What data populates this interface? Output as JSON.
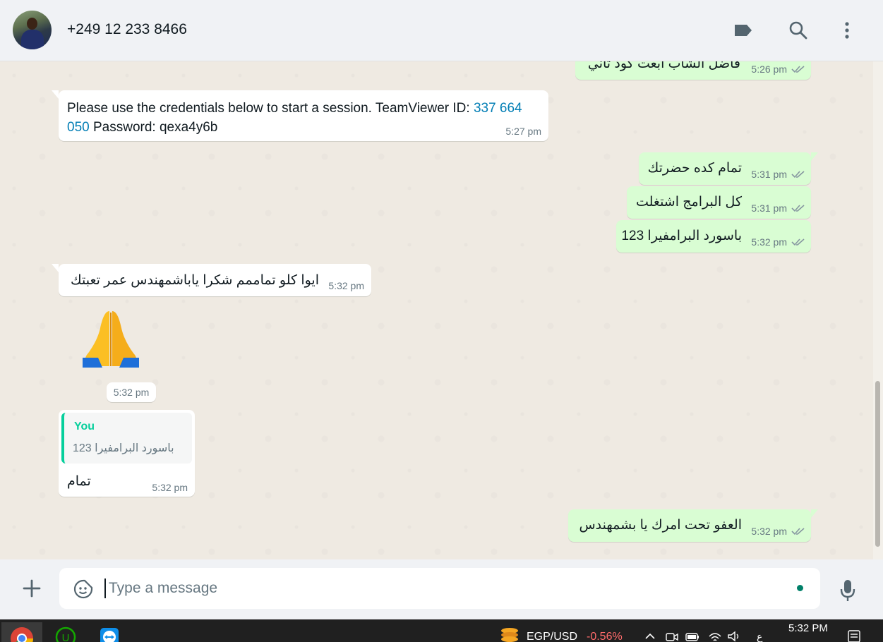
{
  "header": {
    "contact_name": "+249 12 233 8466",
    "icons": [
      "label-icon",
      "search-icon",
      "kebab-menu-icon"
    ]
  },
  "messages": [
    {
      "dir": "out",
      "text": "فاضل الشاب ابعت كود تاني",
      "time": "5:26 pm",
      "status": "read"
    },
    {
      "dir": "in",
      "text_part1": "Please use the credentials below to start a session. TeamViewer ID: ",
      "id_part1": "337 664",
      "id_part2": "050",
      "text_part2": " Password: qexa4y6b",
      "time": "5:27 pm"
    },
    {
      "dir": "out",
      "text": "تمام كده حضرتك",
      "time": "5:31 pm",
      "status": "read"
    },
    {
      "dir": "out",
      "text": "كل البرامج اشتغلت",
      "time": "5:31 pm",
      "status": "read"
    },
    {
      "dir": "out",
      "text": "باسورد البرامفيرا 123",
      "time": "5:32 pm",
      "status": "read"
    },
    {
      "dir": "in",
      "text": "ايوا كلو تماممم شكرا ياباشمهندس عمر تعبتك",
      "time": "5:32 pm"
    },
    {
      "dir": "in",
      "type": "emoji",
      "emoji": "folded-hands",
      "time": "5:32 pm"
    },
    {
      "dir": "in",
      "type": "reply",
      "quote_author": "You",
      "quote_text": "باسورد البرامفيرا 123",
      "text": "تمام",
      "time": "5:32 pm"
    },
    {
      "dir": "out",
      "text": "العفو تحت امرك يا بشمهندس",
      "time": "5:32 pm",
      "status": "read"
    }
  ],
  "composer": {
    "placeholder": "Type a message"
  },
  "taskbar": {
    "currency_label": "EGP/USD",
    "currency_change": "-0.56%",
    "time": "5:32 PM",
    "lang": "ع"
  },
  "colors": {
    "outgoing_bubble": "#d9fdd3",
    "incoming_bubble": "#ffffff",
    "chat_bg": "#efeae2",
    "accent": "#06cf9c",
    "link": "#027eb5",
    "read_tick": "#8696a0"
  }
}
